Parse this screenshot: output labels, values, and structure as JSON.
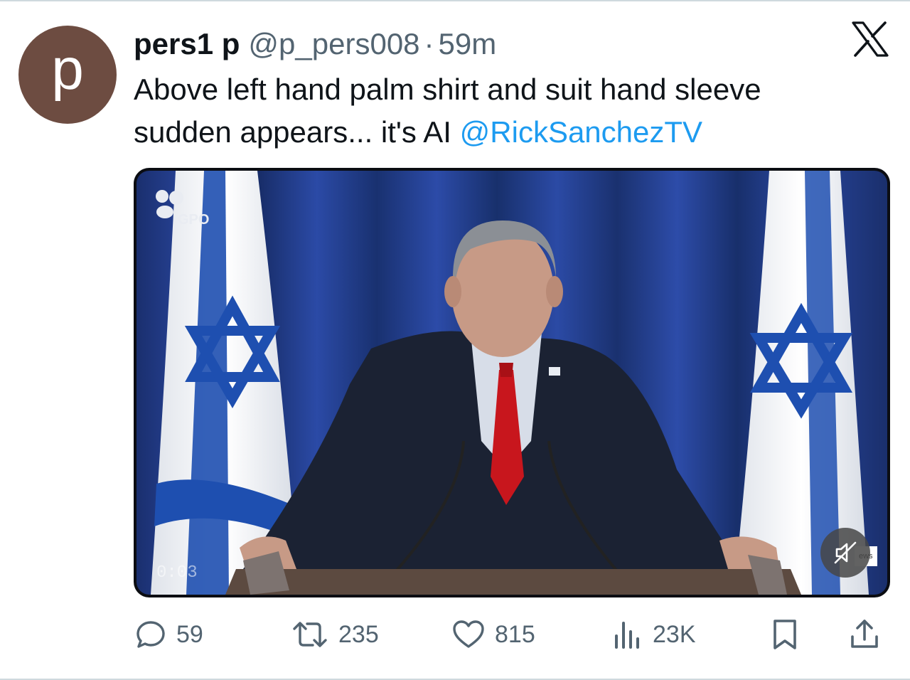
{
  "author": {
    "avatar_letter": "p",
    "avatar_color": "#6d4c41",
    "display_name": "pers1 p",
    "handle": "@p_pers008",
    "separator": "·",
    "time": "59m"
  },
  "tweet": {
    "text_part1": "Above left hand palm shirt and suit hand sleeve sudden appears... it's AI ",
    "mention": "@RickSanchezTV"
  },
  "media": {
    "watermark_logo": "GPO",
    "watermark_timecode": "0:03",
    "corner_badge": "ews",
    "mute_icon": "speaker-muted-icon"
  },
  "actions": {
    "replies": "59",
    "reposts": "235",
    "likes": "815",
    "views": "23K"
  },
  "colors": {
    "accent": "#1d9bf0",
    "secondary_text": "#536471",
    "primary_text": "#0f1419",
    "flag_blue": "#1e4fb0"
  }
}
